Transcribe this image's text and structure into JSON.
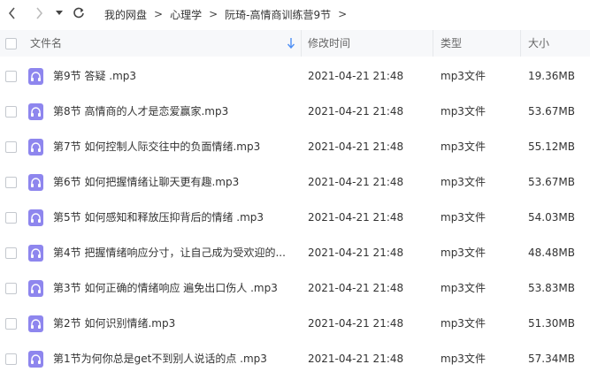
{
  "nav": {
    "breadcrumbs": [
      "我的网盘",
      "心理学",
      "阮琦-高情商训练营9节"
    ],
    "separator": ">"
  },
  "columns": {
    "name": "文件名",
    "modified": "修改时间",
    "type": "类型",
    "size": "大小"
  },
  "colors": {
    "accent": "#4d8ef5",
    "icon": "#8e86ee"
  },
  "icons": {
    "back": "chevron-left-icon",
    "forward": "chevron-right-icon",
    "history": "caret-down-icon",
    "refresh": "refresh-icon",
    "file": "audio-headphones-icon",
    "sort": "sort-down-arrow-icon"
  },
  "files": [
    {
      "name": "第9节 答疑  .mp3",
      "modified": "2021-04-21 21:48",
      "type": "mp3文件",
      "size": "19.36MB"
    },
    {
      "name": "第8节 高情商的人才是恋爱赢家.mp3",
      "modified": "2021-04-21 21:48",
      "type": "mp3文件",
      "size": "53.67MB"
    },
    {
      "name": "第7节 如何控制人际交往中的负面情绪.mp3",
      "modified": "2021-04-21 21:48",
      "type": "mp3文件",
      "size": "55.12MB"
    },
    {
      "name": "第6节 如何把握情绪让聊天更有趣.mp3",
      "modified": "2021-04-21 21:48",
      "type": "mp3文件",
      "size": "53.67MB"
    },
    {
      "name": "第5节 如何感知和释放压抑背后的情绪 .mp3",
      "modified": "2021-04-21 21:48",
      "type": "mp3文件",
      "size": "54.03MB"
    },
    {
      "name": "第4节 把握情绪响应分寸，让自己成为受欢迎的...",
      "modified": "2021-04-21 21:48",
      "type": "mp3文件",
      "size": "48.48MB"
    },
    {
      "name": "第3节 如何正确的情绪响应 遍免出口伤人  .mp3",
      "modified": "2021-04-21 21:48",
      "type": "mp3文件",
      "size": "53.83MB"
    },
    {
      "name": "第2节 如何识别情绪.mp3",
      "modified": "2021-04-21 21:48",
      "type": "mp3文件",
      "size": "51.30MB"
    },
    {
      "name": "第1节为何你总是get不到别人说话的点 .mp3",
      "modified": "2021-04-21 21:48",
      "type": "mp3文件",
      "size": "57.34MB"
    }
  ]
}
